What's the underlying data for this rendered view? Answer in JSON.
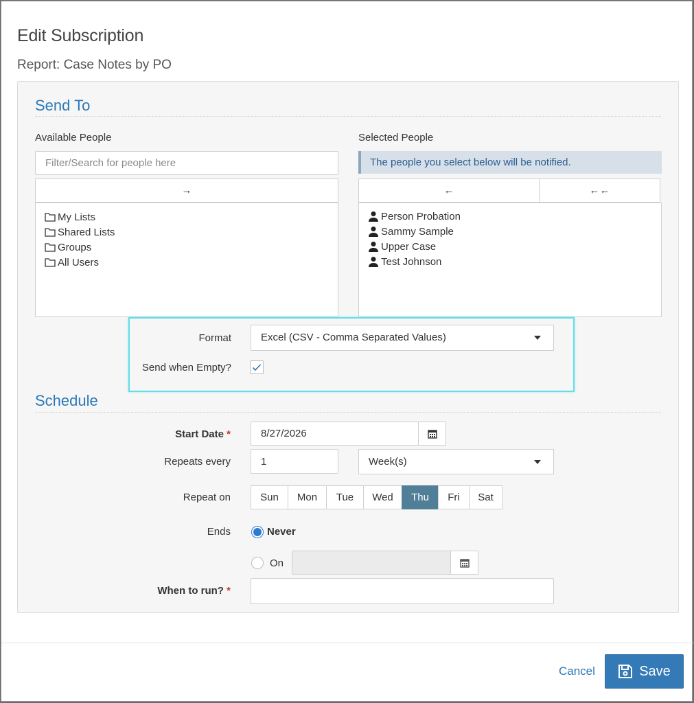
{
  "dialog": {
    "title": "Edit Subscription",
    "subtitle": "Report: Case Notes by PO"
  },
  "send_to": {
    "section_title": "Send To",
    "available_label": "Available People",
    "search_placeholder": "Filter/Search for people here",
    "add_arrow": "→",
    "available_items": [
      {
        "label": "My Lists",
        "icon": "folder-icon"
      },
      {
        "label": "Shared Lists",
        "icon": "folder-icon"
      },
      {
        "label": "Groups",
        "icon": "folder-icon"
      },
      {
        "label": "All Users",
        "icon": "folder-icon"
      }
    ],
    "selected_label": "Selected People",
    "selected_notice": "The people you select below will be notified.",
    "remove_arrow": "←",
    "remove_all_arrow": "←←",
    "selected_items": [
      {
        "label": "Person Probation",
        "icon": "person-icon"
      },
      {
        "label": "Sammy Sample",
        "icon": "person-icon"
      },
      {
        "label": "Upper Case",
        "icon": "person-icon"
      },
      {
        "label": "Test Johnson",
        "icon": "person-icon"
      }
    ]
  },
  "options": {
    "format_label": "Format",
    "format_value": "Excel (CSV - Comma Separated Values)",
    "send_empty_label": "Send when Empty?",
    "send_empty_checked": true
  },
  "schedule": {
    "section_title": "Schedule",
    "start_date_label": "Start Date",
    "required_mark": "*",
    "start_date_value": "8/27/2026",
    "repeats_label": "Repeats every",
    "repeats_value": "1",
    "repeats_unit": "Week(s)",
    "repeat_on_label": "Repeat on",
    "days": [
      "Sun",
      "Mon",
      "Tue",
      "Wed",
      "Thu",
      "Fri",
      "Sat"
    ],
    "active_day": "Thu",
    "ends_label": "Ends",
    "ends_never": "Never",
    "ends_on": "On",
    "ends_selected": "Never",
    "when_label": "When to run?",
    "when_value": ""
  },
  "footer": {
    "cancel_label": "Cancel",
    "save_label": "Save"
  },
  "colors": {
    "primary": "#337ab7",
    "section_title": "#2d78b8",
    "active_day": "#527f98",
    "highlight": "#64dcea",
    "required": "#c0392b"
  }
}
